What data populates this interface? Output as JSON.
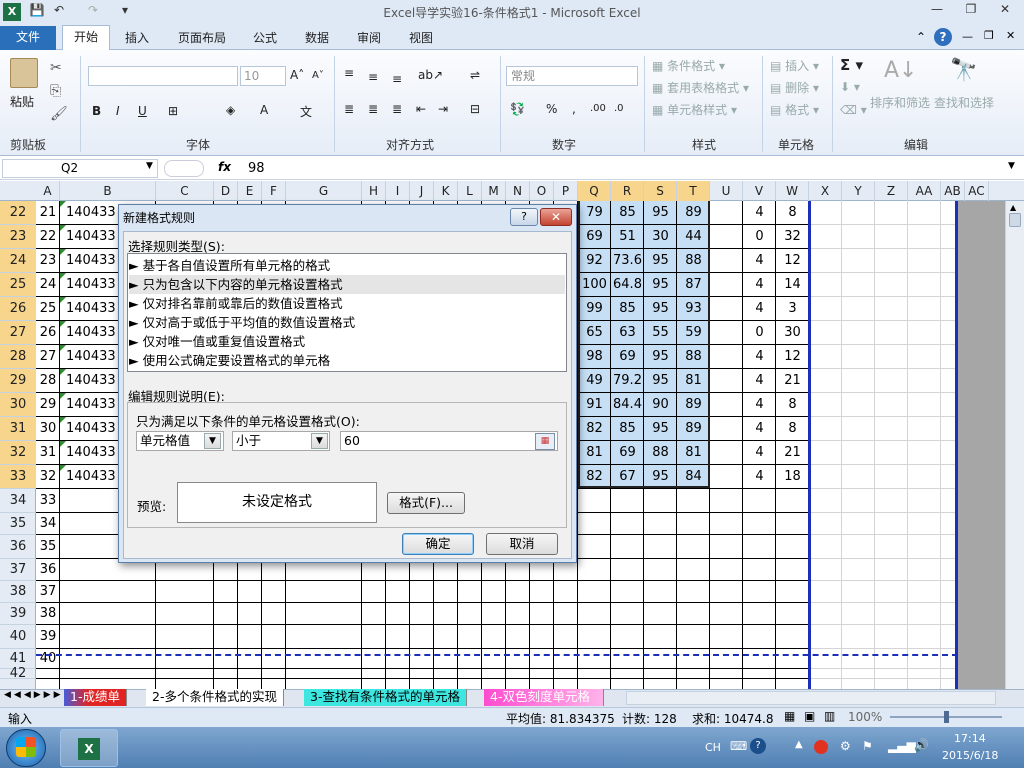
{
  "window": {
    "title": "Excel导学实验16-条件格式1  -  Microsoft Excel"
  },
  "tabs": {
    "file": "文件",
    "home": "开始",
    "insert": "插入",
    "layout": "页面布局",
    "formulas": "公式",
    "data": "数据",
    "review": "审阅",
    "view": "视图"
  },
  "ribbon": {
    "clipboard": {
      "paste": "粘贴",
      "label": "剪贴板"
    },
    "font": {
      "size": "10",
      "label": "字体"
    },
    "align": {
      "label": "对齐方式"
    },
    "number": {
      "format": "常规",
      "label": "数字"
    },
    "styles": {
      "cond": "条件格式",
      "table": "套用表格格式",
      "cell": "单元格样式",
      "label": "样式"
    },
    "cells": {
      "insert": "插入",
      "delete": "删除",
      "format": "格式",
      "label": "单元格"
    },
    "edit": {
      "sort": "排序和筛选",
      "find": "查找和选择",
      "label": "编辑"
    }
  },
  "formula_bar": {
    "name_box": "Q2",
    "fx": "fx",
    "value": "98"
  },
  "columns": [
    "A",
    "B",
    "C",
    "D",
    "E",
    "F",
    "G",
    "H",
    "I",
    "J",
    "K",
    "L",
    "M",
    "N",
    "O",
    "P",
    "Q",
    "R",
    "S",
    "T",
    "U",
    "V",
    "W",
    "X",
    "Y",
    "Z",
    "AA",
    "AB",
    "AC"
  ],
  "rows": [
    {
      "n": "22",
      "a": "21",
      "b": "140433",
      "q": "79",
      "r": "85",
      "s": "95",
      "t": "89",
      "v": "4",
      "w": "8"
    },
    {
      "n": "23",
      "a": "22",
      "b": "140433",
      "q": "69",
      "r": "51",
      "s": "30",
      "t": "44",
      "v": "0",
      "w": "32"
    },
    {
      "n": "24",
      "a": "23",
      "b": "140433",
      "q": "92",
      "r": "73.6",
      "s": "95",
      "t": "88",
      "v": "4",
      "w": "12"
    },
    {
      "n": "25",
      "a": "24",
      "b": "140433",
      "q": "100",
      "r": "64.8",
      "s": "95",
      "t": "87",
      "v": "4",
      "w": "14"
    },
    {
      "n": "26",
      "a": "25",
      "b": "140433",
      "q": "99",
      "r": "85",
      "s": "95",
      "t": "93",
      "v": "4",
      "w": "3"
    },
    {
      "n": "27",
      "a": "26",
      "b": "140433",
      "q": "65",
      "r": "63",
      "s": "55",
      "t": "59",
      "v": "0",
      "w": "30"
    },
    {
      "n": "28",
      "a": "27",
      "b": "140433",
      "q": "98",
      "r": "69",
      "s": "95",
      "t": "88",
      "v": "4",
      "w": "12"
    },
    {
      "n": "29",
      "a": "28",
      "b": "140433",
      "q": "49",
      "r": "79.2",
      "s": "95",
      "t": "81",
      "v": "4",
      "w": "21"
    },
    {
      "n": "30",
      "a": "29",
      "b": "140433",
      "q": "91",
      "r": "84.4",
      "s": "90",
      "t": "89",
      "v": "4",
      "w": "8"
    },
    {
      "n": "31",
      "a": "30",
      "b": "140433",
      "q": "82",
      "r": "85",
      "s": "95",
      "t": "89",
      "v": "4",
      "w": "8"
    },
    {
      "n": "32",
      "a": "31",
      "b": "140433",
      "q": "81",
      "r": "69",
      "s": "88",
      "t": "81",
      "v": "4",
      "w": "21"
    },
    {
      "n": "33",
      "a": "32",
      "b": "140433",
      "q": "82",
      "r": "67",
      "s": "95",
      "t": "84",
      "v": "4",
      "w": "18"
    },
    {
      "n": "34",
      "a": "33"
    },
    {
      "n": "35",
      "a": "34"
    },
    {
      "n": "36",
      "a": "35"
    },
    {
      "n": "37",
      "a": "36"
    },
    {
      "n": "38",
      "a": "37"
    },
    {
      "n": "39",
      "a": "38"
    },
    {
      "n": "40",
      "a": "39"
    },
    {
      "n": "41",
      "a": "40"
    },
    {
      "n": "42",
      "a": ""
    }
  ],
  "dialog": {
    "title": "新建格式规则",
    "help": "?",
    "close": "✕",
    "select_type_label": "选择规则类型(S):",
    "rule_types": [
      "► 基于各自值设置所有单元格的格式",
      "► 只为包含以下内容的单元格设置格式",
      "► 仅对排名靠前或靠后的数值设置格式",
      "► 仅对高于或低于平均值的数值设置格式",
      "► 仅对唯一值或重复值设置格式",
      "► 使用公式确定要设置格式的单元格"
    ],
    "edit_desc_label": "编辑规则说明(E):",
    "condition_label": "只为满足以下条件的单元格设置格式(O):",
    "field1": "单元格值",
    "field2": "小于",
    "field3": "60",
    "preview_label": "预览:",
    "preview_text": "未设定格式",
    "format_btn": "格式(F)...",
    "ok": "确定",
    "cancel": "取消"
  },
  "sheet_tabs": [
    "1-成绩单",
    "2-多个条件格式的实现",
    "3-查找有条件格式的单元格",
    "4-双色刻度单元格"
  ],
  "status": {
    "mode": "输入",
    "avg": "平均值: 81.834375",
    "count": "计数: 128",
    "sum": "求和: 10474.8",
    "zoom": "100%"
  },
  "taskbar": {
    "lang": "CH",
    "time": "17:14",
    "date": "2015/6/18"
  }
}
